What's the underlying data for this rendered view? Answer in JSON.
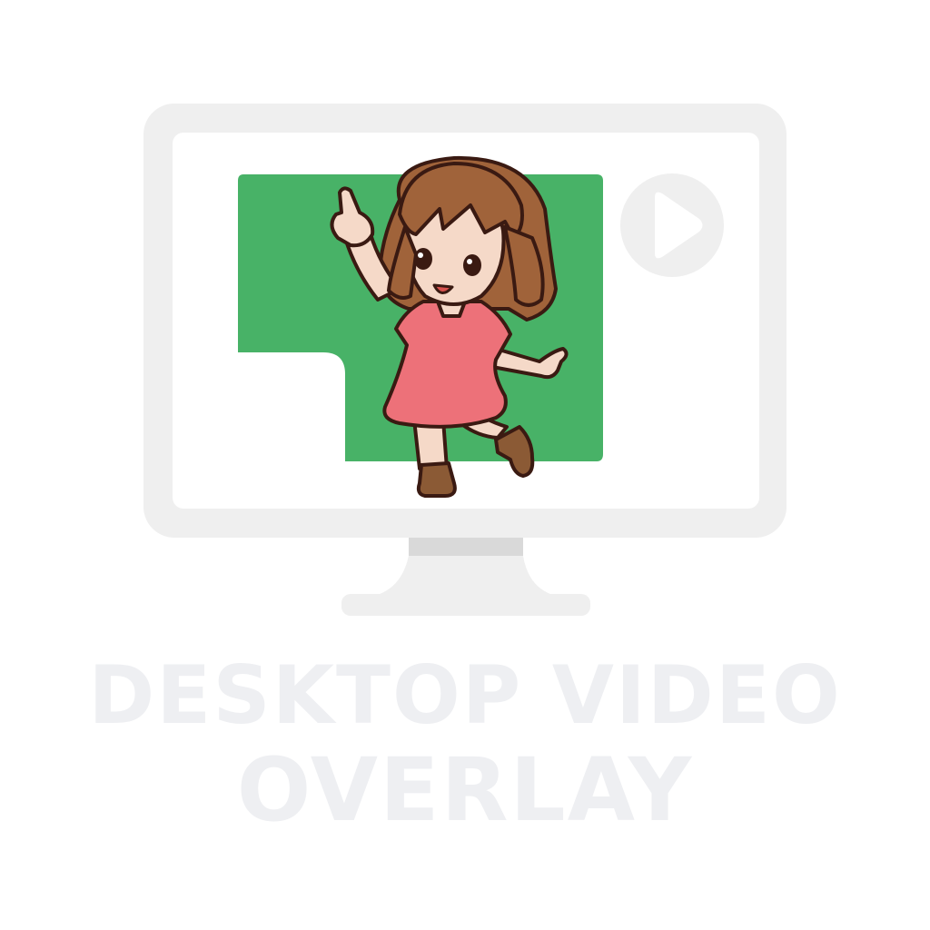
{
  "title": {
    "line1": "DESKTOP VIDEO",
    "line2": "OVERLAY"
  },
  "icons": {
    "monitor": "monitor-icon",
    "play": "play-icon",
    "character": "dancing-girl-character"
  },
  "colors": {
    "monitor_frame": "#efefef",
    "monitor_stand": "#d9d9d9",
    "screen": "#ffffff",
    "green_screen": "#48b267",
    "title_text": "#eeeff2",
    "hair": "#a0633a",
    "skin": "#f5d9c8",
    "dress": "#ed7179",
    "boots": "#8b5a35",
    "outline": "#3a1a12"
  }
}
